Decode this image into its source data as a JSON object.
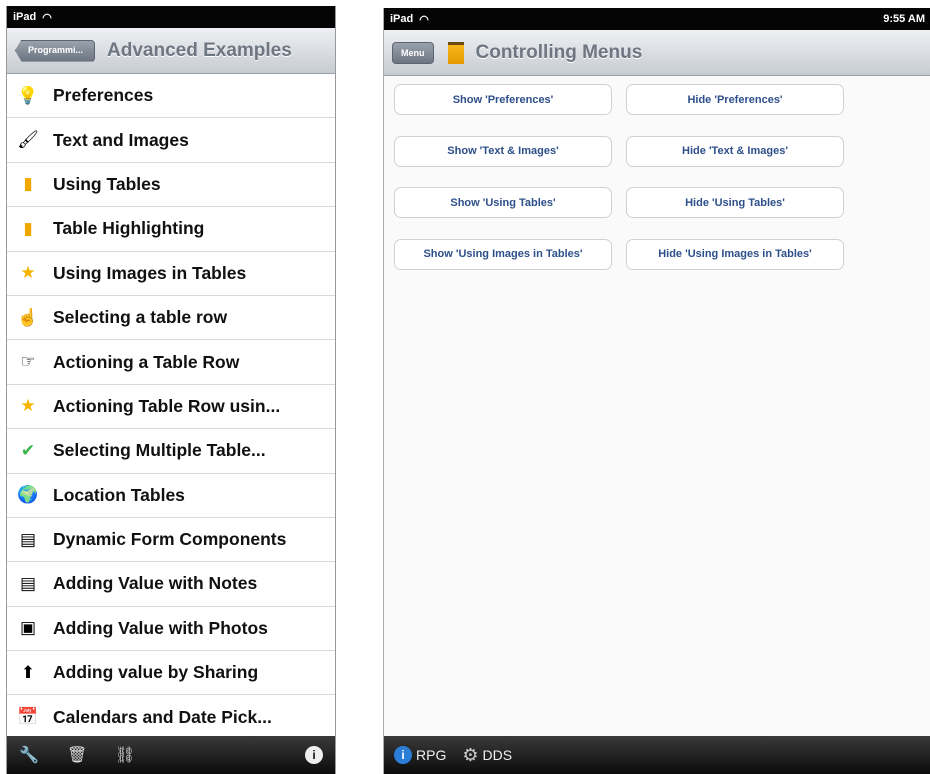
{
  "left": {
    "status": {
      "carrier": "iPad"
    },
    "nav": {
      "back": "Programmi...",
      "title": "Advanced Examples"
    },
    "items": [
      {
        "label": "Preferences",
        "icon": "lightbulb-icon",
        "glyph": "💡"
      },
      {
        "label": "Text and Images",
        "icon": "brush-icon",
        "glyph": "🖌"
      },
      {
        "label": "Using Tables",
        "icon": "book-icon",
        "glyph": "▮"
      },
      {
        "label": "Table Highlighting",
        "icon": "book-icon",
        "glyph": "▮"
      },
      {
        "label": "Using Images in Tables",
        "icon": "star-icon",
        "glyph": "★"
      },
      {
        "label": "Selecting a table row",
        "icon": "hand-icon",
        "glyph": "☝"
      },
      {
        "label": "Actioning a Table Row",
        "icon": "pointing-hand-icon",
        "glyph": "☞"
      },
      {
        "label": "Actioning Table Row usin...",
        "icon": "star-icon",
        "glyph": "★"
      },
      {
        "label": "Selecting Multiple Table...",
        "icon": "checkmark-icon",
        "glyph": "✔"
      },
      {
        "label": "Location Tables",
        "icon": "globe-icon",
        "glyph": "🌍"
      },
      {
        "label": "Dynamic Form Components",
        "icon": "form-icon",
        "glyph": "▤"
      },
      {
        "label": "Adding Value with Notes",
        "icon": "notes-icon",
        "glyph": "▤"
      },
      {
        "label": "Adding Value with Photos",
        "icon": "photo-icon",
        "glyph": "▣"
      },
      {
        "label": "Adding value by Sharing",
        "icon": "share-icon",
        "glyph": "⬆"
      },
      {
        "label": "Calendars and Date Pick...",
        "icon": "calendar-icon",
        "glyph": "📅"
      }
    ],
    "toolbar": {
      "tools": "🔧",
      "trash": "🗑",
      "link": "⛓",
      "info": "i"
    }
  },
  "right": {
    "status": {
      "carrier": "iPad",
      "time": "9:55 AM"
    },
    "nav": {
      "menu": "Menu",
      "title": "Controlling Menus"
    },
    "buttons": [
      [
        "Show 'Preferences'",
        "Hide 'Preferences'"
      ],
      [
        "Show 'Text & Images'",
        "Hide 'Text & Images'"
      ],
      [
        "Show 'Using Tables'",
        "Hide 'Using Tables'"
      ],
      [
        "Show 'Using Images in Tables'",
        "Hide 'Using Images in Tables'"
      ]
    ],
    "bottom": {
      "rpg": "RPG",
      "dds": "DDS",
      "info": "i",
      "gear": "⚙"
    }
  },
  "colors": {
    "star": "#f4b400",
    "book": "#f0a800",
    "check": "#3bb54a",
    "button_text": "#2d4f8a"
  }
}
